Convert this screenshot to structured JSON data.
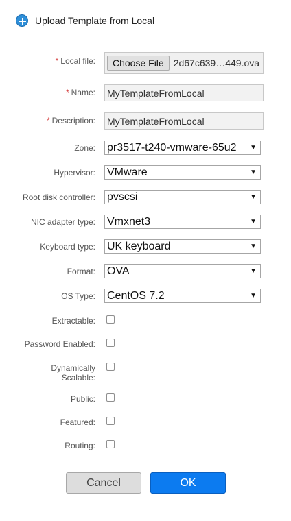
{
  "dialog": {
    "title": "Upload Template from Local",
    "icon": "plus-circle-icon"
  },
  "colors": {
    "accent": "#0c7bf0",
    "required": "#d53d3d"
  },
  "fields": {
    "local_file": {
      "label": "Local file:",
      "required": "*",
      "button": "Choose File",
      "filename": "2d67c639…449.ova"
    },
    "name": {
      "label": "Name:",
      "required": "*",
      "value": "MyTemplateFromLocal"
    },
    "description": {
      "label": "Description:",
      "required": "*",
      "value": "MyTemplateFromLocal"
    },
    "zone": {
      "label": "Zone:",
      "value": "pr3517-t240-vmware-65u2"
    },
    "hypervisor": {
      "label": "Hypervisor:",
      "value": "VMware"
    },
    "root_disk_controller": {
      "label": "Root disk controller:",
      "value": "pvscsi"
    },
    "nic_adapter_type": {
      "label": "NIC adapter type:",
      "value": "Vmxnet3"
    },
    "keyboard_type": {
      "label": "Keyboard type:",
      "value": "UK keyboard"
    },
    "format": {
      "label": "Format:",
      "value": "OVA"
    },
    "os_type": {
      "label": "OS Type:",
      "value": "CentOS 7.2"
    },
    "extractable": {
      "label": "Extractable:",
      "checked": false
    },
    "password_enabled": {
      "label": "Password Enabled:",
      "checked": false
    },
    "dynamically_scalable": {
      "label": "Dynamically Scalable:",
      "checked": false
    },
    "public": {
      "label": "Public:",
      "checked": false
    },
    "featured": {
      "label": "Featured:",
      "checked": false
    },
    "routing": {
      "label": "Routing:",
      "checked": false
    }
  },
  "actions": {
    "cancel": "Cancel",
    "ok": "OK"
  },
  "dropdown_arrow": "▼"
}
